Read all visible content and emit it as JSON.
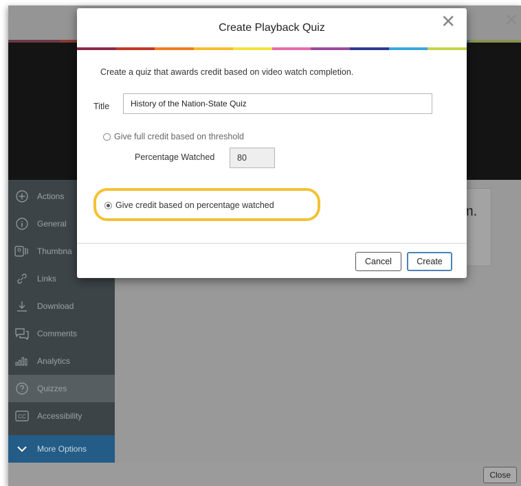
{
  "modal": {
    "title": "Create Playback Quiz",
    "close_icon": "close-icon",
    "description": "Create a quiz that awards credit based on video watch completion.",
    "title_label": "Title",
    "title_value": "History of the Nation-State Quiz",
    "option_threshold": {
      "label": "Give full credit based on threshold",
      "selected": false
    },
    "percentage_label": "Percentage Watched",
    "percentage_value": "80",
    "option_percentage": {
      "label": "Give credit based on percentage watched",
      "selected": true
    },
    "cancel_label": "Cancel",
    "create_label": "Create",
    "highlight_color": "#f3c233",
    "colorbar": [
      "#8a2a4a",
      "#c2392b",
      "#ef7f21",
      "#f6bd2b",
      "#f5e23a",
      "#e76aa8",
      "#9a4b9e",
      "#2e3a8c",
      "#3aa6dd",
      "#c5d44a"
    ]
  },
  "sidebar": {
    "items": [
      {
        "label": "Actions",
        "icon": "plus-circle-icon"
      },
      {
        "label": "General",
        "icon": "info-icon"
      },
      {
        "label": "Thumbna",
        "icon": "thumbnail-icon"
      },
      {
        "label": "Links",
        "icon": "link-icon"
      },
      {
        "label": "Download",
        "icon": "download-icon"
      },
      {
        "label": "Comments",
        "icon": "comments-icon"
      },
      {
        "label": "Analytics",
        "icon": "analytics-icon"
      },
      {
        "label": "Quizzes",
        "icon": "question-icon"
      },
      {
        "label": "Accessibility",
        "icon": "cc-icon"
      },
      {
        "label": "More Options",
        "icon": "chevron-down-icon"
      }
    ]
  },
  "main": {
    "partial_text": "m."
  },
  "footer": {
    "close_label": "Close"
  },
  "colors": {
    "sidebar": "#3d4448",
    "sidebar_active": "#565e62",
    "more_options": "#235c86",
    "create_border": "#4a82b8"
  }
}
